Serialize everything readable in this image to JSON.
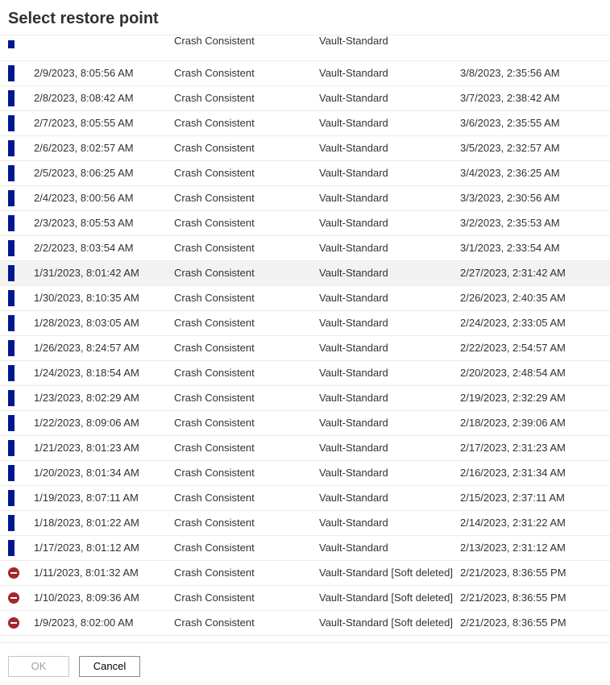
{
  "title": "Select restore point",
  "partial_row": {
    "consistency": "Crash Consistent",
    "tier": "Vault-Standard"
  },
  "rows": [
    {
      "indicator": "bar",
      "time": "2/9/2023, 8:05:56 AM",
      "consistency": "Crash Consistent",
      "tier": "Vault-Standard",
      "expiry": "3/8/2023, 2:35:56 AM"
    },
    {
      "indicator": "bar",
      "time": "2/8/2023, 8:08:42 AM",
      "consistency": "Crash Consistent",
      "tier": "Vault-Standard",
      "expiry": "3/7/2023, 2:38:42 AM"
    },
    {
      "indicator": "bar",
      "time": "2/7/2023, 8:05:55 AM",
      "consistency": "Crash Consistent",
      "tier": "Vault-Standard",
      "expiry": "3/6/2023, 2:35:55 AM"
    },
    {
      "indicator": "bar",
      "time": "2/6/2023, 8:02:57 AM",
      "consistency": "Crash Consistent",
      "tier": "Vault-Standard",
      "expiry": "3/5/2023, 2:32:57 AM"
    },
    {
      "indicator": "bar",
      "time": "2/5/2023, 8:06:25 AM",
      "consistency": "Crash Consistent",
      "tier": "Vault-Standard",
      "expiry": "3/4/2023, 2:36:25 AM"
    },
    {
      "indicator": "bar",
      "time": "2/4/2023, 8:00:56 AM",
      "consistency": "Crash Consistent",
      "tier": "Vault-Standard",
      "expiry": "3/3/2023, 2:30:56 AM"
    },
    {
      "indicator": "bar",
      "time": "2/3/2023, 8:05:53 AM",
      "consistency": "Crash Consistent",
      "tier": "Vault-Standard",
      "expiry": "3/2/2023, 2:35:53 AM"
    },
    {
      "indicator": "bar",
      "time": "2/2/2023, 8:03:54 AM",
      "consistency": "Crash Consistent",
      "tier": "Vault-Standard",
      "expiry": "3/1/2023, 2:33:54 AM"
    },
    {
      "indicator": "bar",
      "time": "1/31/2023, 8:01:42 AM",
      "consistency": "Crash Consistent",
      "tier": "Vault-Standard",
      "expiry": "2/27/2023, 2:31:42 AM",
      "hovered": true
    },
    {
      "indicator": "bar",
      "time": "1/30/2023, 8:10:35 AM",
      "consistency": "Crash Consistent",
      "tier": "Vault-Standard",
      "expiry": "2/26/2023, 2:40:35 AM"
    },
    {
      "indicator": "bar",
      "time": "1/28/2023, 8:03:05 AM",
      "consistency": "Crash Consistent",
      "tier": "Vault-Standard",
      "expiry": "2/24/2023, 2:33:05 AM"
    },
    {
      "indicator": "bar",
      "time": "1/26/2023, 8:24:57 AM",
      "consistency": "Crash Consistent",
      "tier": "Vault-Standard",
      "expiry": "2/22/2023, 2:54:57 AM"
    },
    {
      "indicator": "bar",
      "time": "1/24/2023, 8:18:54 AM",
      "consistency": "Crash Consistent",
      "tier": "Vault-Standard",
      "expiry": "2/20/2023, 2:48:54 AM"
    },
    {
      "indicator": "bar",
      "time": "1/23/2023, 8:02:29 AM",
      "consistency": "Crash Consistent",
      "tier": "Vault-Standard",
      "expiry": "2/19/2023, 2:32:29 AM"
    },
    {
      "indicator": "bar",
      "time": "1/22/2023, 8:09:06 AM",
      "consistency": "Crash Consistent",
      "tier": "Vault-Standard",
      "expiry": "2/18/2023, 2:39:06 AM"
    },
    {
      "indicator": "bar",
      "time": "1/21/2023, 8:01:23 AM",
      "consistency": "Crash Consistent",
      "tier": "Vault-Standard",
      "expiry": "2/17/2023, 2:31:23 AM"
    },
    {
      "indicator": "bar",
      "time": "1/20/2023, 8:01:34 AM",
      "consistency": "Crash Consistent",
      "tier": "Vault-Standard",
      "expiry": "2/16/2023, 2:31:34 AM"
    },
    {
      "indicator": "bar",
      "time": "1/19/2023, 8:07:11 AM",
      "consistency": "Crash Consistent",
      "tier": "Vault-Standard",
      "expiry": "2/15/2023, 2:37:11 AM"
    },
    {
      "indicator": "bar",
      "time": "1/18/2023, 8:01:22 AM",
      "consistency": "Crash Consistent",
      "tier": "Vault-Standard",
      "expiry": "2/14/2023, 2:31:22 AM"
    },
    {
      "indicator": "bar",
      "time": "1/17/2023, 8:01:12 AM",
      "consistency": "Crash Consistent",
      "tier": "Vault-Standard",
      "expiry": "2/13/2023, 2:31:12 AM"
    },
    {
      "indicator": "deleted",
      "time": "1/11/2023, 8:01:32 AM",
      "consistency": "Crash Consistent",
      "tier": "Vault-Standard [Soft deleted]",
      "expiry": "2/21/2023, 8:36:55 PM"
    },
    {
      "indicator": "deleted",
      "time": "1/10/2023, 8:09:36 AM",
      "consistency": "Crash Consistent",
      "tier": "Vault-Standard [Soft deleted]",
      "expiry": "2/21/2023, 8:36:55 PM"
    },
    {
      "indicator": "deleted",
      "time": "1/9/2023, 8:02:00 AM",
      "consistency": "Crash Consistent",
      "tier": "Vault-Standard [Soft deleted]",
      "expiry": "2/21/2023, 8:36:55 PM"
    }
  ],
  "buttons": {
    "ok": "OK",
    "cancel": "Cancel"
  }
}
